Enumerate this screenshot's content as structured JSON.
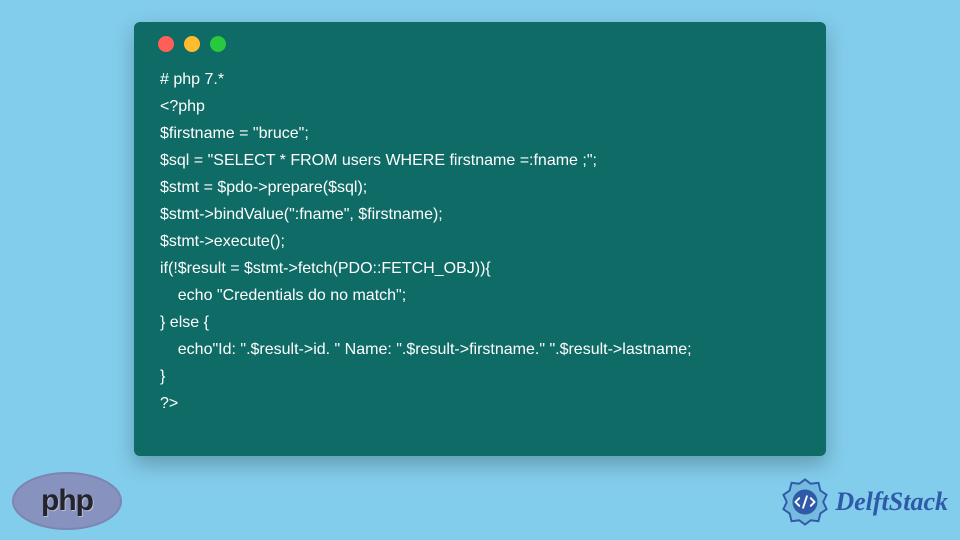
{
  "code": {
    "lines": [
      "# php 7.*",
      "<?php",
      "$firstname = \"bruce\";",
      "$sql = \"SELECT * FROM users WHERE firstname =:fname ;\";",
      "$stmt = $pdo->prepare($sql);",
      "$stmt->bindValue(\":fname\", $firstname);",
      "$stmt->execute();",
      "if(!$result = $stmt->fetch(PDO::FETCH_OBJ)){",
      "    echo \"Credentials do no match\";",
      "} else {",
      "    echo\"Id: \".$result->id. \" Name: \".$result->firstname.\" \".$result->lastname;",
      "}",
      "?>"
    ]
  },
  "php_logo": {
    "text": "php"
  },
  "brand": {
    "text": "DelftStack"
  }
}
